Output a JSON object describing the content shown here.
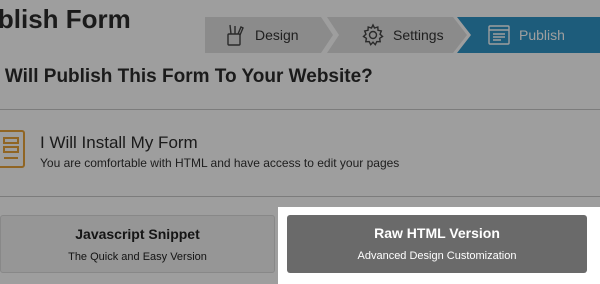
{
  "header": {
    "title": "ublish Form"
  },
  "steps": [
    {
      "label": "Design",
      "icon": "design-tools-icon"
    },
    {
      "label": "Settings",
      "icon": "gear-icon"
    },
    {
      "label": "Publish",
      "icon": "browser-window-icon",
      "active": true
    }
  ],
  "question": "o Will Publish This Form To Your Website?",
  "install_option": {
    "title": "I Will Install My Form",
    "description": "You are comfortable with HTML and have access to edit your pages",
    "icon": "form-layout-icon"
  },
  "versions": [
    {
      "title": "Javascript Snippet",
      "subtitle": "The Quick and Easy Version"
    },
    {
      "title": "Raw HTML Version",
      "subtitle": "Advanced Design Customization",
      "highlighted": true
    }
  ],
  "colors": {
    "accent": "#2f95c7",
    "icon_orange": "#e8a33a",
    "highlight_card": "#6a6a6a"
  }
}
